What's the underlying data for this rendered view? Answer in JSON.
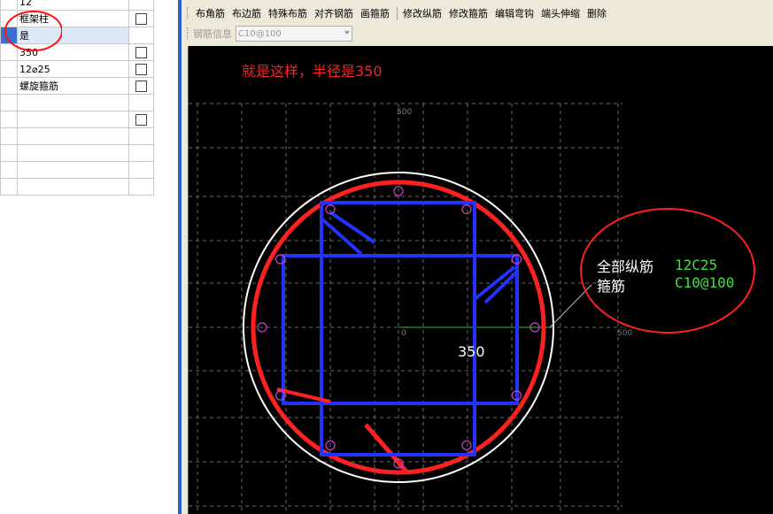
{
  "properties": {
    "rows": [
      {
        "value": "12",
        "checkbox": false
      },
      {
        "value": "框架柱",
        "checkbox": true
      },
      {
        "value": "是",
        "checkbox": false,
        "selected": true
      },
      {
        "value": "350",
        "checkbox": true
      },
      {
        "value": "12⌀25",
        "checkbox": true
      },
      {
        "value": "螺旋箍筋",
        "checkbox": true
      },
      {
        "value": "",
        "checkbox": false
      },
      {
        "value": "",
        "checkbox": true
      },
      {
        "value": "",
        "checkbox": false
      },
      {
        "value": "",
        "checkbox": false
      },
      {
        "value": "",
        "checkbox": false
      },
      {
        "value": "",
        "checkbox": false
      }
    ]
  },
  "toolbar": {
    "buttons_group1": [
      "布角筋",
      "布边筋",
      "特殊布筋",
      "对齐钢筋",
      "画箍筋"
    ],
    "buttons_group2": [
      "修改纵筋",
      "修改箍筋",
      "编辑弯钩",
      "端头伸缩",
      "删除"
    ],
    "rebar_info_label": "钢筋信息",
    "rebar_info_value": "C10@100"
  },
  "canvas": {
    "annotation_note": "就是这样，半径是350",
    "radius_label": "350",
    "info": {
      "longitudinal_label": "全部纵筋",
      "longitudinal_value": "12C25",
      "stirrup_label": "箍筋",
      "stirrup_value": "C10@100"
    },
    "axis_ticks": {
      "top": "500",
      "origin": "0",
      "right": "500"
    },
    "colors": {
      "background": "#000000",
      "column_outline": "#ffffff",
      "annotation": "#ff2020",
      "stirrup": "#2233ff",
      "rebar": "#d040d0",
      "info_value": "#40e040",
      "axis": "#30c030",
      "grid": "#6a6a6a"
    }
  }
}
